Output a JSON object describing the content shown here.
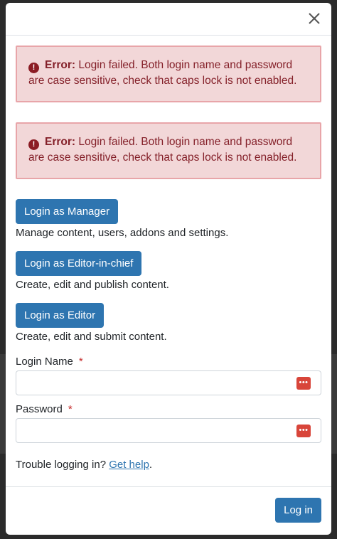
{
  "close_label": "×",
  "alerts": [
    {
      "label": "Error:",
      "message": "Login failed. Both login name and password are case sensitive, check that caps lock is not enabled."
    },
    {
      "label": "Error:",
      "message": "Login failed. Both login name and password are case sensitive, check that caps lock is not enabled."
    }
  ],
  "roles": [
    {
      "button": "Login as Manager",
      "description": "Manage content, users, addons and settings."
    },
    {
      "button": "Login as Editor-in-chief",
      "description": "Create, edit and publish content."
    },
    {
      "button": "Login as Editor",
      "description": "Create, edit and submit content."
    }
  ],
  "fields": {
    "login_name": {
      "label": "Login Name",
      "required_mark": "*",
      "value": ""
    },
    "password": {
      "label": "Password",
      "required_mark": "*",
      "value": ""
    }
  },
  "help": {
    "prefix": "Trouble logging in? ",
    "link": "Get help",
    "suffix": "."
  },
  "footer": {
    "submit_label": "Log in"
  },
  "colors": {
    "primary": "#2e75b0",
    "alert_bg": "#f2d7d8",
    "alert_text": "#842029",
    "required": "#c52b2b"
  },
  "icons": {
    "close": "close-icon",
    "error": "exclamation-circle-icon",
    "password_manager": "password-manager-icon"
  }
}
